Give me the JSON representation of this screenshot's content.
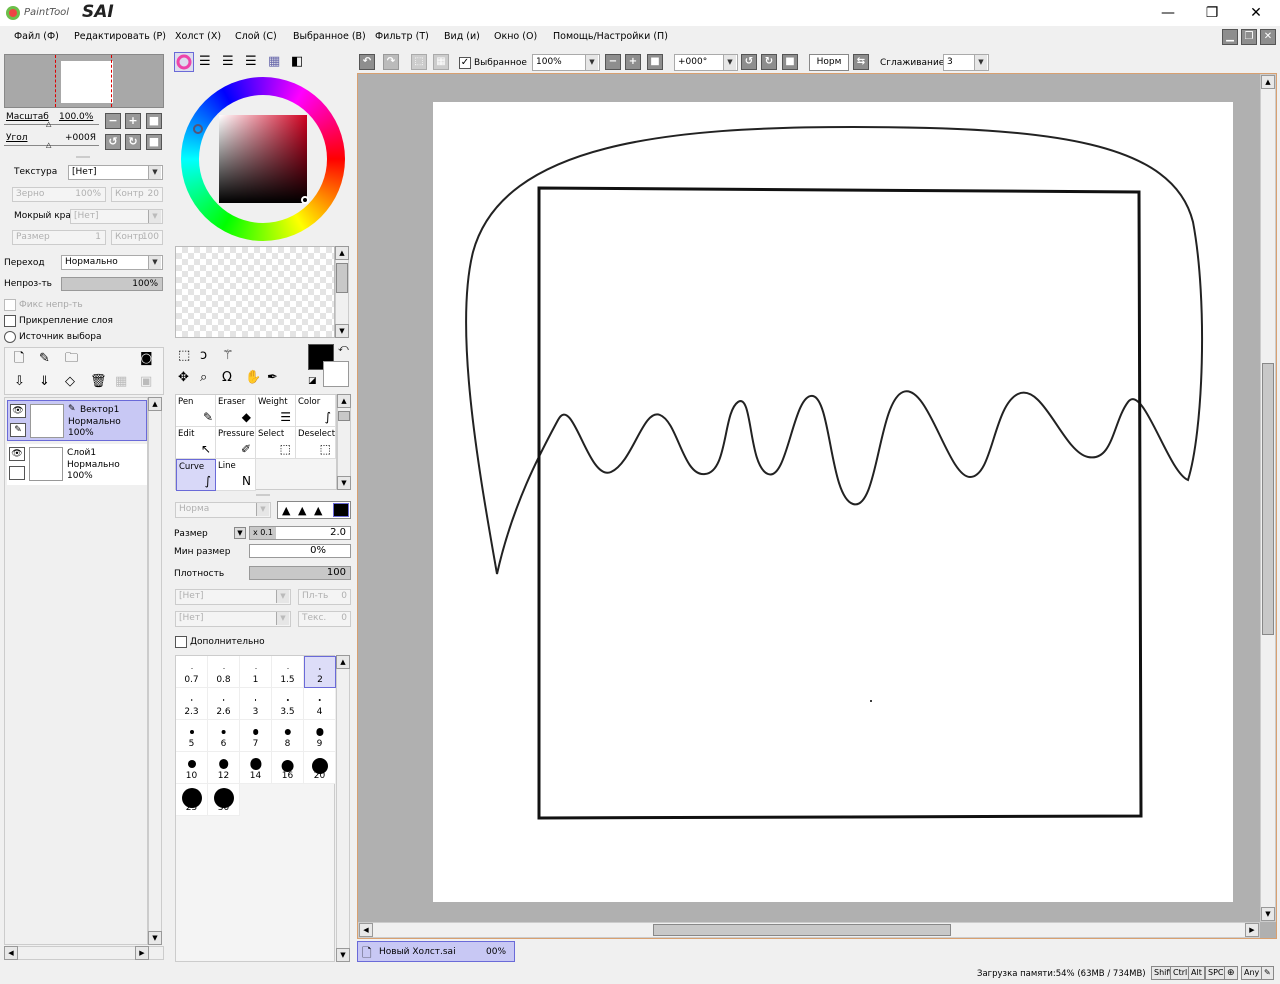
{
  "app": {
    "logo_small": "PaintTool",
    "logo_big": "SAI",
    "win_min": "—",
    "win_max": "❐",
    "win_close": "✕"
  },
  "menu": [
    "Файл (Ф)",
    "Редактировать (Р)",
    "Холст (Х)",
    "Слой (С)",
    "Выбранное (В)",
    "Фильтр (Т)",
    "Вид (и)",
    "Окно (О)",
    "Помощь/Настройки (П)"
  ],
  "navigator": {
    "zoom_label": "Масштаб",
    "zoom_value": "100.0%",
    "angle_label": "Угол",
    "angle_value": "+000Я"
  },
  "paper": {
    "texture_label": "Текстура",
    "texture_value": "[Нет]",
    "grain_label": "Зерно",
    "grain_value": "100%",
    "contrast_label": "Контр",
    "contrast_value": "20",
    "wet_label": "Мокрый край",
    "wet_value": "[Нет]",
    "size_label": "Размер",
    "size_value": "1",
    "contrast2_label": "Контр",
    "contrast2_value": "100"
  },
  "layer_props": {
    "blend_label": "Переход",
    "blend_value": "Нормально",
    "opacity_label": "Непроз-ть",
    "opacity_value": "100%",
    "opacity_fraction": 1.0,
    "fix_opacity": "Фикс непр-ть",
    "clip_layer": "Прикрепление слоя",
    "selection_source": "Источник выбора"
  },
  "layers": [
    {
      "name": "Вектор1",
      "mode": "Нормально",
      "opacity": "100%",
      "selected": true
    },
    {
      "name": "Слой1",
      "mode": "Нормально",
      "opacity": "100%",
      "selected": false
    }
  ],
  "tools": [
    {
      "label": "Pen",
      "icon": "✎"
    },
    {
      "label": "Eraser",
      "icon": "◆"
    },
    {
      "label": "Weight",
      "icon": "☰"
    },
    {
      "label": "Color",
      "icon": "∫"
    },
    {
      "label": "Edit",
      "icon": "↖"
    },
    {
      "label": "Pressure",
      "icon": "✐"
    },
    {
      "label": "Select",
      "icon": "⬚"
    },
    {
      "label": "Deselect",
      "icon": "⬚"
    },
    {
      "label": "Curve",
      "icon": "∫"
    },
    {
      "label": "Line",
      "icon": "N"
    }
  ],
  "brush": {
    "mode_value": "Норма",
    "size_label": "Размер",
    "size_mult": "x 0.1",
    "size_value": "2.0",
    "min_size_label": "Мин размер",
    "min_size_value": "0%",
    "density_label": "Плотность",
    "density_value": "100",
    "density_fraction": 1.0,
    "shape_value": "[Нет]",
    "shape_amount_label": "Пл-ть",
    "shape_amount_value": "0",
    "texture_value": "[Нет]",
    "texture_amount_label": "Текс.",
    "texture_amount_value": "0",
    "advanced_label": "Дополнительно"
  },
  "brush_sizes": [
    "0.7",
    "0.8",
    "1",
    "1.5",
    "2",
    "2.3",
    "2.6",
    "3",
    "3.5",
    "4",
    "5",
    "6",
    "7",
    "8",
    "9",
    "10",
    "12",
    "14",
    "16",
    "20",
    "25",
    "30"
  ],
  "toolbar": {
    "selection_label": "Выбранное",
    "zoom_value": "100%",
    "angle_value": "+000°",
    "mode_value": "Норм",
    "smoothing_label": "Сглаживание",
    "smoothing_value": "3"
  },
  "tab": {
    "name": "Новый Холст.sai",
    "percent": "00%"
  },
  "status": {
    "memory": "Загрузка памяти:54% (63MB / 734MB)",
    "keys": [
      "Shift",
      "Ctrl",
      "Alt",
      "SPC",
      "Any"
    ]
  },
  "colors": {
    "primary": "#000000",
    "secondary": "#ffffff",
    "canvas_bg": "#b0b0b0",
    "selection": "#6a6ad8"
  }
}
